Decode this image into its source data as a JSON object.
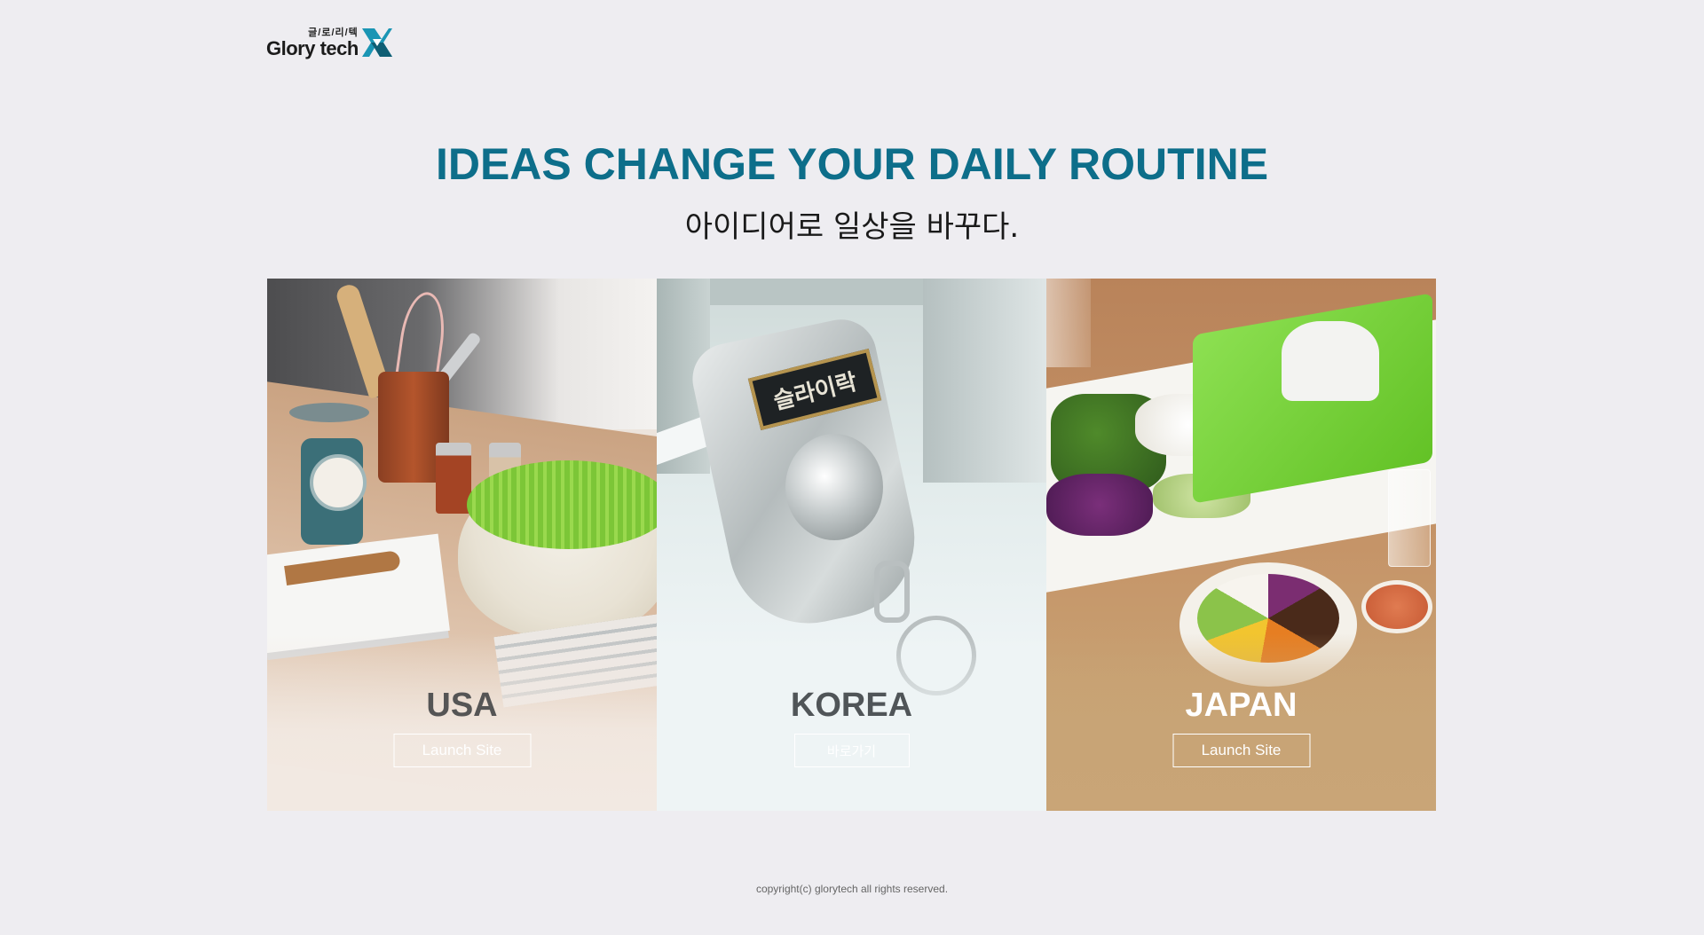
{
  "logo": {
    "korean": "글/로/리/텍",
    "word": "Glory tech",
    "accent_color": "#1a95b4"
  },
  "hero": {
    "title": "IDEAS CHANGE YOUR DAILY ROUTINE",
    "subtitle": "아이디어로 일상을 바꾸다.",
    "title_color": "#0d6e8a"
  },
  "cards": [
    {
      "label": "USA",
      "button": "Launch Site"
    },
    {
      "label": "KOREA",
      "button": "바로가기",
      "plaque": "슬라이락"
    },
    {
      "label": "JAPAN",
      "button": "Launch Site"
    }
  ],
  "footer": {
    "copyright": "copyright(c) glorytech all rights reserved."
  }
}
